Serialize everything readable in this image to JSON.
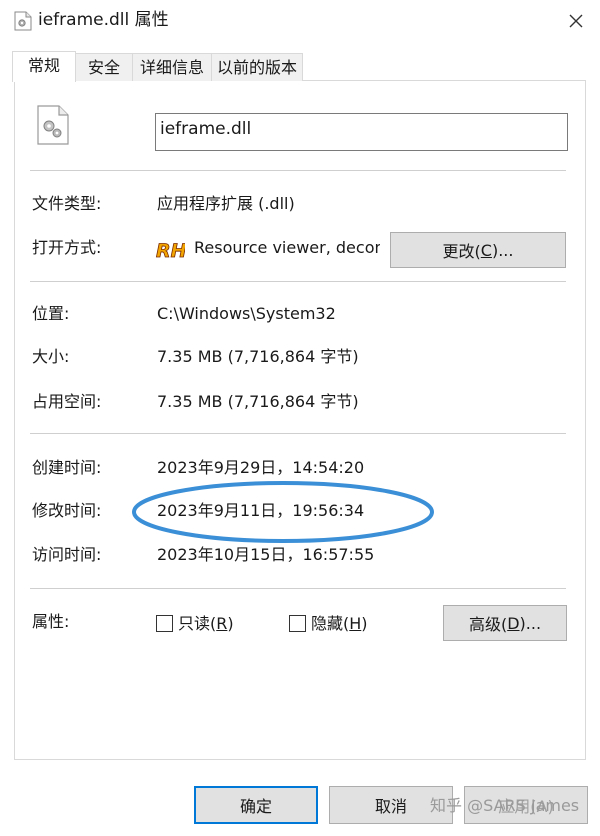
{
  "window": {
    "title": "ieframe.dll 属性",
    "close_icon": "close-icon"
  },
  "tabs": [
    {
      "label": "常规",
      "active": true
    },
    {
      "label": "安全",
      "active": false
    },
    {
      "label": "详细信息",
      "active": false
    },
    {
      "label": "以前的版本",
      "active": false
    }
  ],
  "file": {
    "icon": "dll-gear-file-icon",
    "name": "ieframe.dll"
  },
  "type_section": {
    "file_type_label": "文件类型:",
    "file_type_value": "应用程序扩展 (.dll)",
    "open_with_label": "打开方式:",
    "open_with_icon_text": "RH",
    "open_with_value": "Resource viewer, decom",
    "change_button": {
      "pre": "更改(",
      "key": "C",
      "post": ")..."
    }
  },
  "location_section": {
    "location_label": "位置:",
    "location_value": "C:\\Windows\\System32",
    "size_label": "大小:",
    "size_value": "7.35 MB (7,716,864 字节)",
    "disk_size_label": "占用空间:",
    "disk_size_value": "7.35 MB (7,716,864 字节)"
  },
  "time_section": {
    "created_label": "创建时间:",
    "created_value": "2023年9月29日，14:54:20",
    "modified_label": "修改时间:",
    "modified_value": "2023年9月11日，19:56:34",
    "accessed_label": "访问时间:",
    "accessed_value": "2023年10月15日，16:57:55",
    "highlight_color": "#3b8fd6"
  },
  "attributes": {
    "label": "属性:",
    "readonly": {
      "pre": "只读(",
      "key": "R",
      "post": ")",
      "checked": false
    },
    "hidden": {
      "pre": "隐藏(",
      "key": "H",
      "post": ")",
      "checked": false
    },
    "advanced_button": {
      "pre": "高级(",
      "key": "D",
      "post": ")..."
    }
  },
  "footer": {
    "ok_label": "确定",
    "cancel_label": "取消",
    "apply_label": "应用(A)",
    "watermark": "知乎 @SARS James"
  },
  "colors": {
    "accent": "#0078d7",
    "button_bg": "#e1e1e1",
    "border": "#d9d9d9"
  }
}
